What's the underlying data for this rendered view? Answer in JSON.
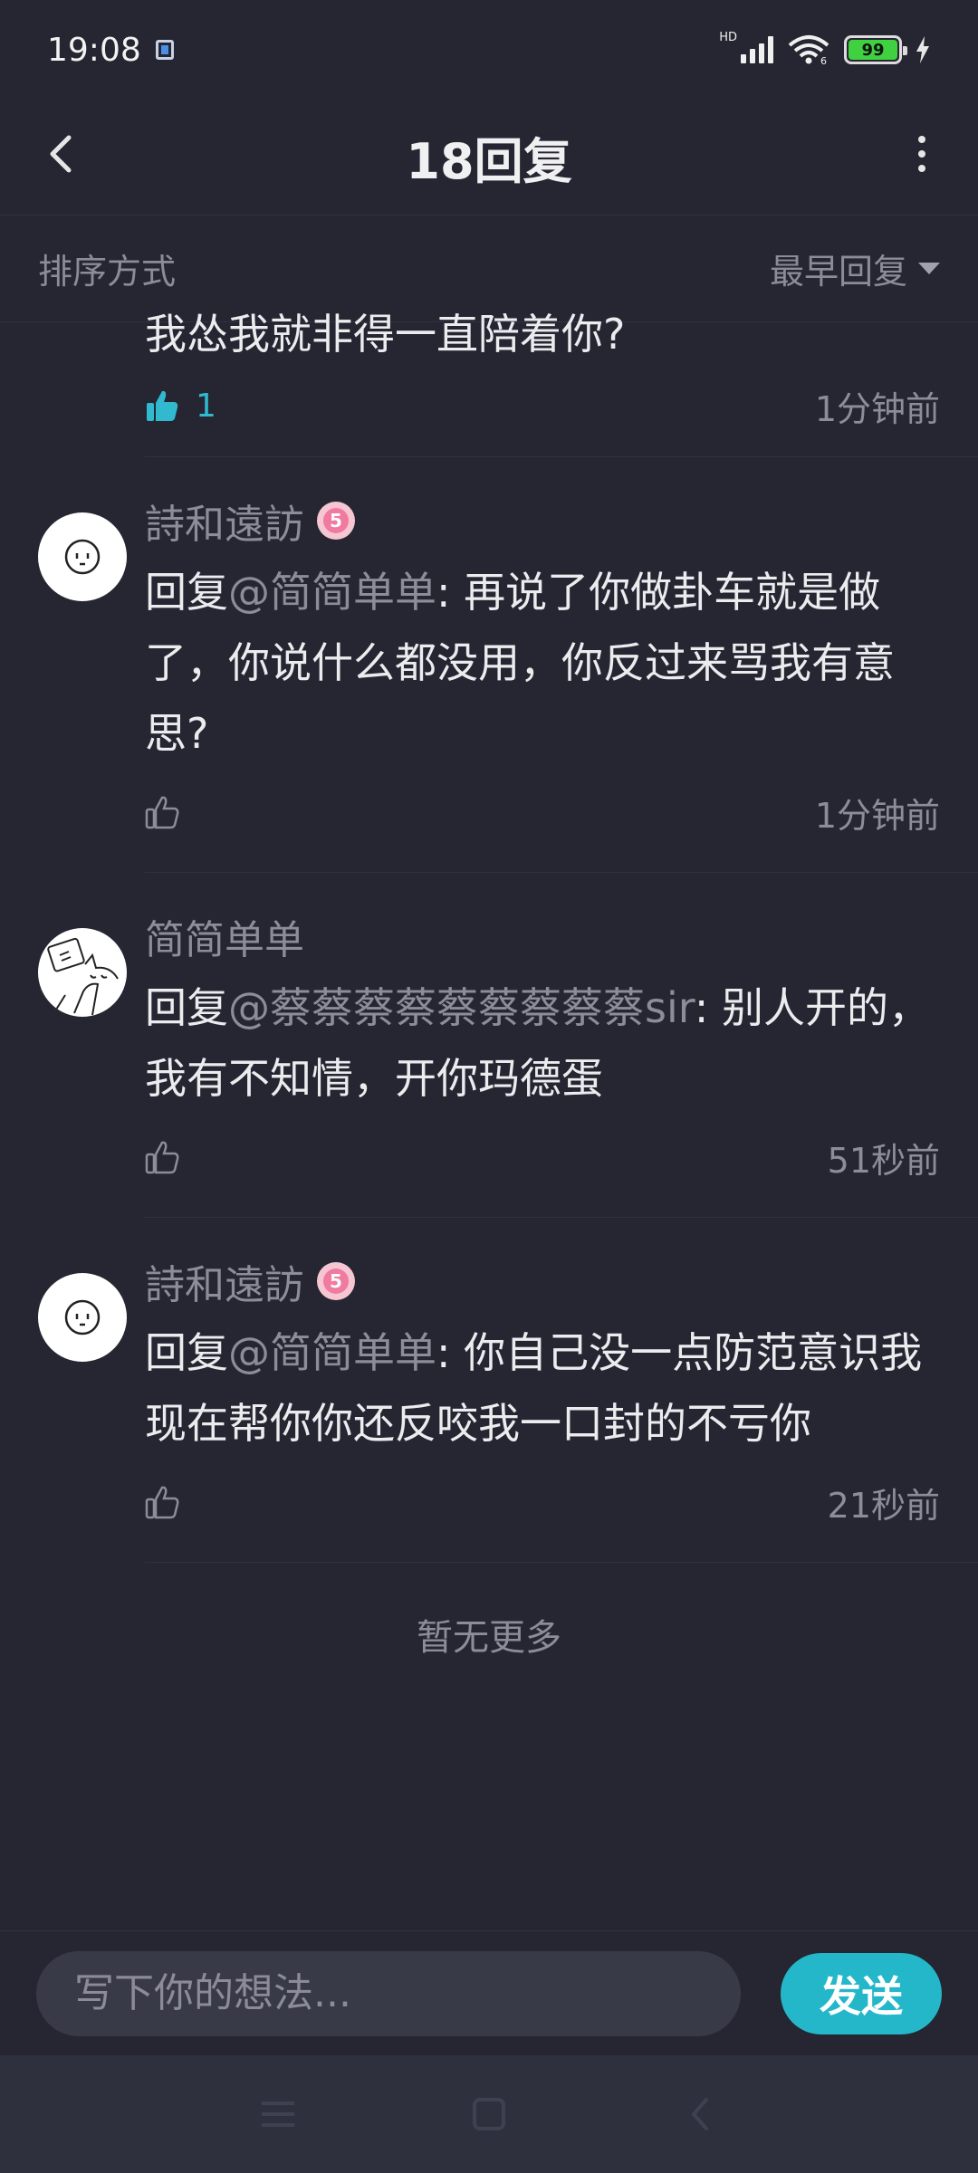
{
  "status_bar": {
    "time": "19:08",
    "network_label": "HD",
    "network_sub": "6",
    "battery": "99"
  },
  "header": {
    "title": "18回复",
    "back_icon": "chevron-left-icon",
    "more_icon": "more-vertical-icon"
  },
  "sort": {
    "label": "排序方式",
    "selected": "最早回复"
  },
  "first_item": {
    "text": "我怂我就非得一直陪着你?",
    "like_count": "1",
    "time": "1分钟前"
  },
  "comments": [
    {
      "name": "詩和遠訪",
      "badge": "5",
      "prefix": "回复",
      "mention": "@简简单单",
      "text": ": 再说了你做卦车就是做了，你说什么都没用，你反过来骂我有意思?",
      "time": "1分钟前"
    },
    {
      "name": "简简单单",
      "prefix": "回复",
      "mention": "@蔡蔡蔡蔡蔡蔡蔡蔡蔡sir",
      "text": ": 别人开的，我有不知情，开你玛德蛋",
      "time": "51秒前"
    },
    {
      "name": "詩和遠訪",
      "badge": "5",
      "prefix": "回复",
      "mention": "@简简单单",
      "text": ": 你自己没一点防范意识我现在帮你你还反咬我一口封的不亏你",
      "time": "21秒前"
    }
  ],
  "no_more": "暂无更多",
  "composer": {
    "placeholder": "写下你的想法...",
    "send_label": "发送"
  },
  "colors": {
    "background": "#252632",
    "accent": "#24b7c9",
    "muted_text": "#8c8d98"
  }
}
